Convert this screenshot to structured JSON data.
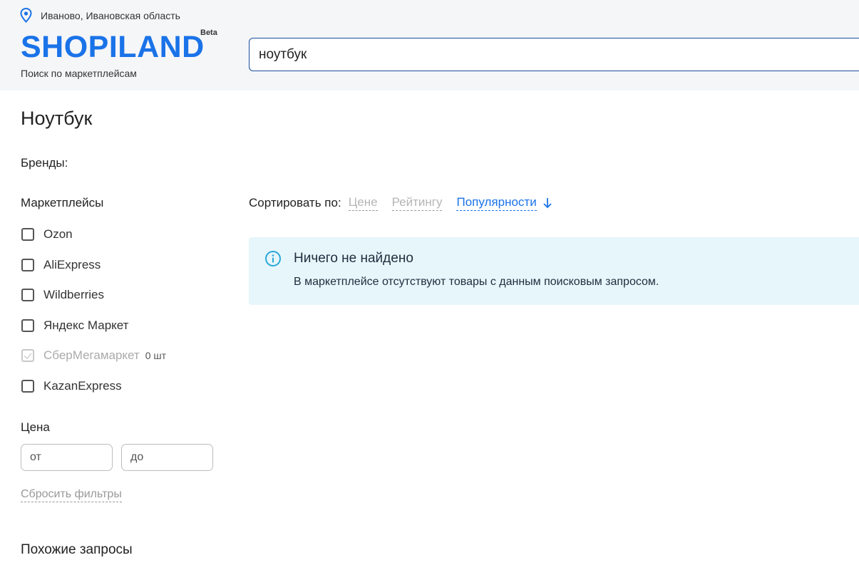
{
  "header": {
    "location": "Иваново, Ивановская область",
    "logo": "SHOPILAND",
    "beta": "Beta",
    "tagline": "Поиск по маркетплейсам",
    "search_value": "ноутбук"
  },
  "page_title": "Ноутбук",
  "filters": {
    "brands_label": "Бренды:",
    "marketplaces_label": "Маркетплейсы",
    "marketplaces": [
      {
        "label": "Ozon",
        "disabled": false
      },
      {
        "label": "AliExpress",
        "disabled": false
      },
      {
        "label": "Wildberries",
        "disabled": false
      },
      {
        "label": "Яндекс Маркет",
        "disabled": false
      },
      {
        "label": "СберМегамаркет",
        "disabled": true,
        "count": "0 шт"
      },
      {
        "label": "KazanExpress",
        "disabled": false
      }
    ],
    "price_label": "Цена",
    "price_from_placeholder": "от",
    "price_to_placeholder": "до",
    "reset_label": "Сбросить фильтры"
  },
  "similar_label": "Похожие запросы",
  "sort": {
    "label": "Сортировать по:",
    "options": [
      "Цене",
      "Рейтингу",
      "Популярности"
    ],
    "active": "Популярности",
    "direction_icon": "arrow-down-icon"
  },
  "alert": {
    "title": "Ничего не найдено",
    "text": "В маркетплейсе отсутствуют товары с данным поисковым запросом."
  },
  "colors": {
    "brand": "#1a73e8",
    "alert_bg": "#e6f6fb",
    "alert_icon": "#29a9d8"
  }
}
